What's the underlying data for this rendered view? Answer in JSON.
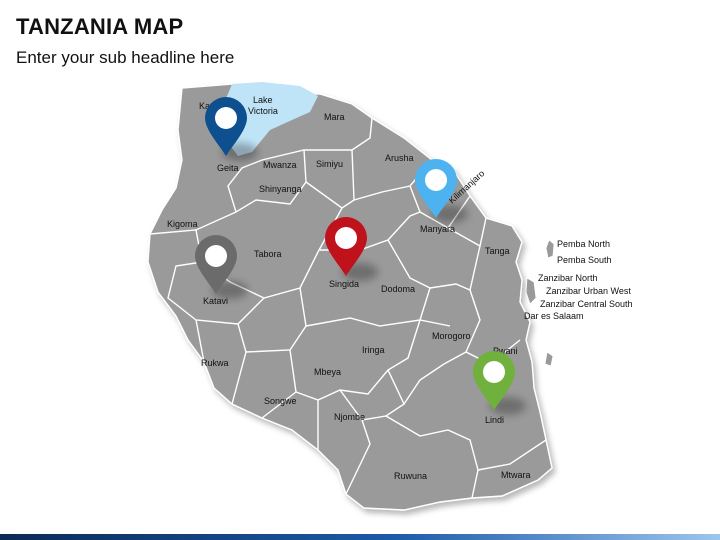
{
  "header": {
    "title": "TANZANIA MAP",
    "subtitle": "Enter your sub headline here"
  },
  "map": {
    "country_color": "#9a9a9a",
    "border_color": "#ffffff",
    "lake_color": "#bfe3f7",
    "lake_label": "Lake\nVictoria",
    "regions": [
      "Ka",
      "Mara",
      "Geita",
      "Mwanza",
      "Simiyu",
      "Arusha",
      "Shinyanga",
      "Kilimanjaro",
      "Kigoma",
      "Tabora",
      "Singida",
      "Manyara",
      "Tanga",
      "Katavi",
      "Dodoma",
      "Morogoro",
      "Pwani",
      "Rukwa",
      "Iringa",
      "Mbeya",
      "Songwe",
      "Njombe",
      "Lindi",
      "Ruwuna",
      "Mtwara"
    ],
    "islands": [
      "Pemba North",
      "Pemba South",
      "Zanzibar North",
      "Zanzibar Urban West",
      "Zanzibar Central South",
      "Dar es Salaam"
    ],
    "pins": [
      {
        "region": "Geita",
        "color": "#0d4f8f"
      },
      {
        "region": "Manyara",
        "color": "#4cb3f0"
      },
      {
        "region": "Singida",
        "color": "#c0121b"
      },
      {
        "region": "Katavi",
        "color": "#6b6b6b"
      },
      {
        "region": "Lindi",
        "color": "#6fb13c"
      }
    ]
  }
}
